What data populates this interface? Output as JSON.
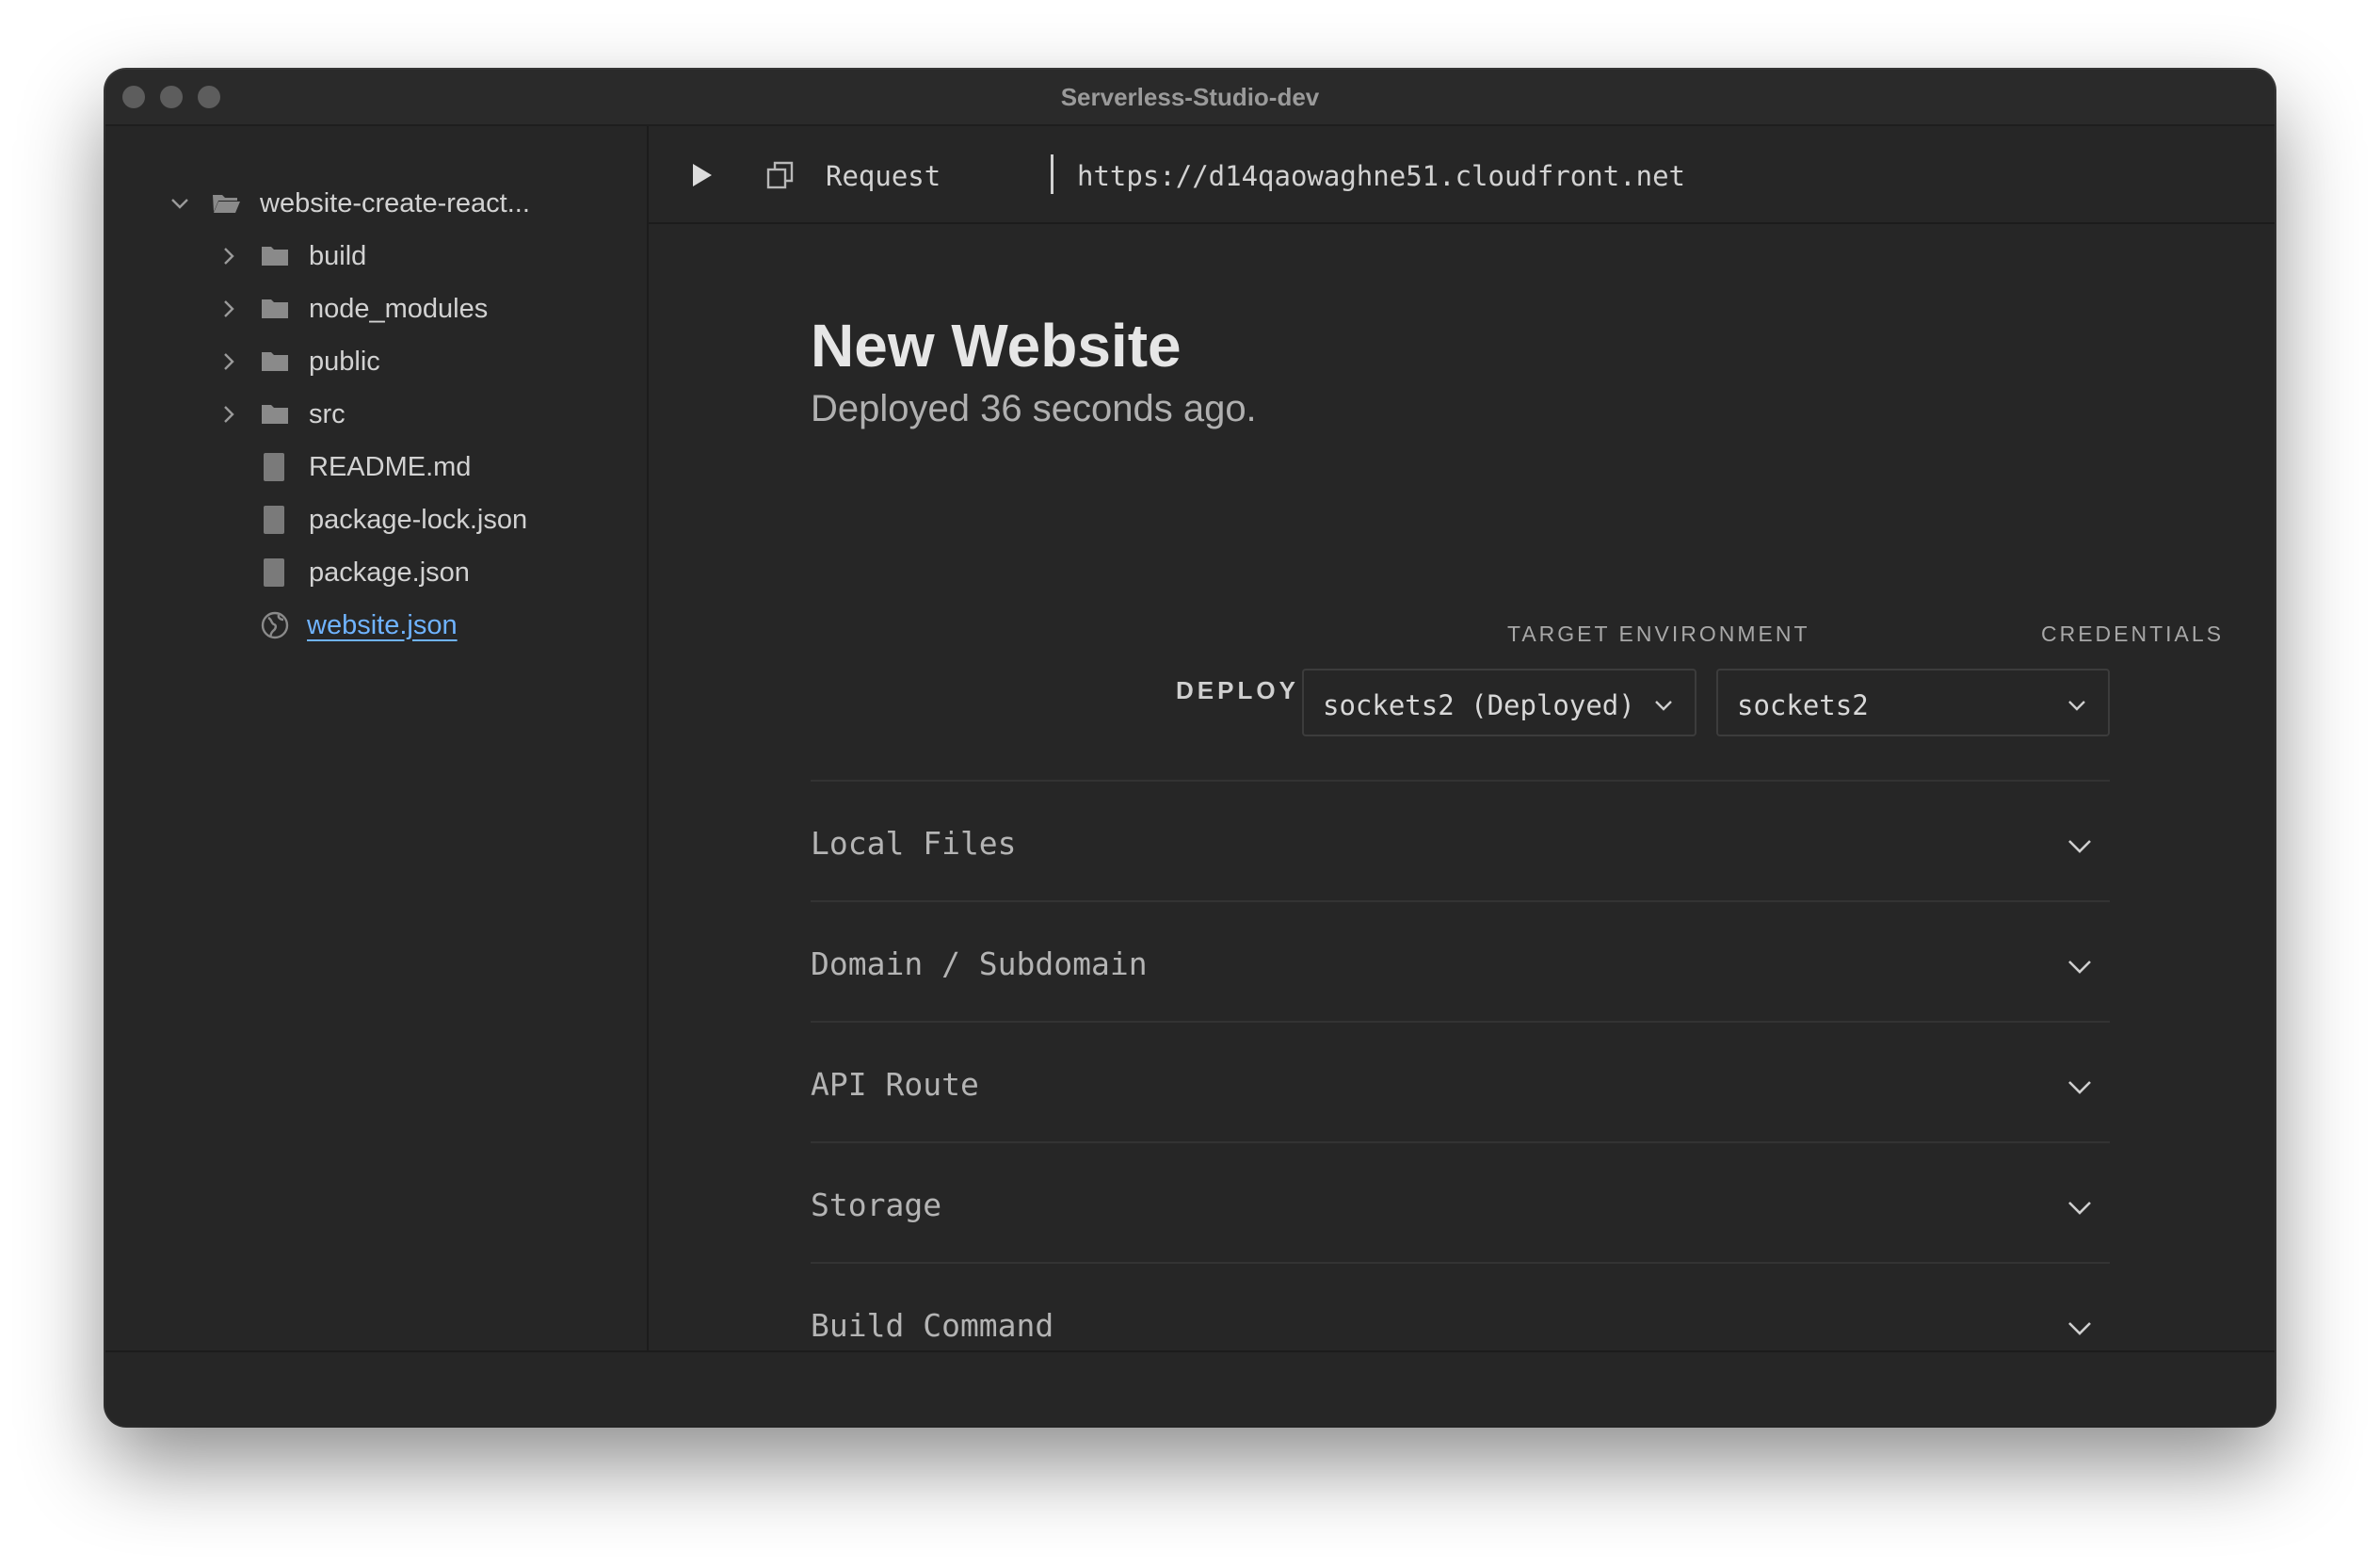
{
  "window": {
    "title": "Serverless-Studio-dev"
  },
  "sidebar": {
    "root": {
      "label": "website-create-react...",
      "icon": "folder-open-icon"
    },
    "items": [
      {
        "label": "build",
        "type": "folder"
      },
      {
        "label": "node_modules",
        "type": "folder"
      },
      {
        "label": "public",
        "type": "folder"
      },
      {
        "label": "src",
        "type": "folder"
      },
      {
        "label": "README.md",
        "type": "file"
      },
      {
        "label": "package-lock.json",
        "type": "file"
      },
      {
        "label": "package.json",
        "type": "file"
      },
      {
        "label": "website.json",
        "type": "globe",
        "selected": true
      }
    ]
  },
  "toolbar": {
    "request_label": "Request",
    "url": "https://d14qaowaghne51.cloudfront.net"
  },
  "main": {
    "title": "New Website",
    "subtitle": "Deployed 36 seconds ago.",
    "deploy_label": "DEPLOY",
    "target_env": {
      "label": "TARGET ENVIRONMENT",
      "value": "sockets2 (Deployed)"
    },
    "credentials": {
      "label": "CREDENTIALS",
      "value": "sockets2"
    },
    "sections": [
      {
        "label": "Local Files"
      },
      {
        "label": "Domain / Subdomain"
      },
      {
        "label": "API Route"
      },
      {
        "label": "Storage"
      },
      {
        "label": "Build Command"
      }
    ]
  },
  "colors": {
    "background": "#262626",
    "text": "#d2d2d2",
    "link": "#6fb3ff"
  }
}
